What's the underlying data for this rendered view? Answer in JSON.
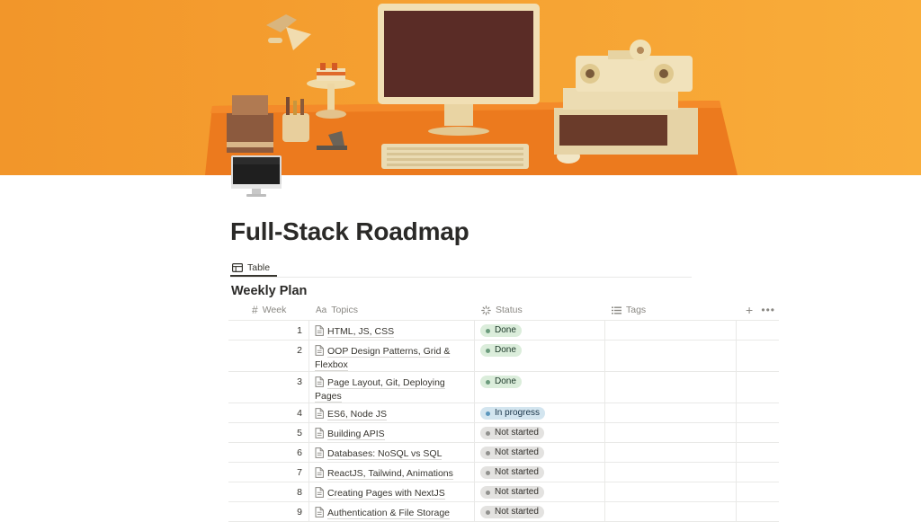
{
  "page": {
    "title": "Full-Stack Roadmap",
    "view_tab": "Table",
    "database_title": "Weekly Plan"
  },
  "columns": {
    "week": "Week",
    "topics": "Topics",
    "status": "Status",
    "tags": "Tags"
  },
  "icons": {
    "cover": "orange-desk-computer-illustration",
    "page_icon": "desktop-computer-icon",
    "view_tab": "table-icon",
    "week_col": "number-hash-icon",
    "topics_col": "text-aa-icon",
    "status_col": "status-loader-icon",
    "tags_col": "list-icon",
    "row_page": "document-icon",
    "add_column": "plus-icon",
    "more": "ellipsis-icon"
  },
  "status_styles": {
    "Done": {
      "bg": "#dbeddb",
      "dot": "#6c9b7d",
      "fg": "#1c3829"
    },
    "In progress": {
      "bg": "#d3e5ef",
      "dot": "#5b97bd",
      "fg": "#183347"
    },
    "Not started": {
      "bg": "#e3e2e0",
      "dot": "#91918e",
      "fg": "#32302c"
    }
  },
  "rows": [
    {
      "week": "1",
      "topic": "HTML, JS, CSS",
      "status": "Done"
    },
    {
      "week": "2",
      "topic": "OOP Design Patterns, Grid & Flexbox",
      "status": "Done"
    },
    {
      "week": "3",
      "topic": "Page Layout, Git, Deploying Pages",
      "status": "Done"
    },
    {
      "week": "4",
      "topic": "ES6, Node JS",
      "status": "In progress"
    },
    {
      "week": "5",
      "topic": "Building APIS",
      "status": "Not started"
    },
    {
      "week": "6",
      "topic": "Databases: NoSQL vs SQL",
      "status": "Not started"
    },
    {
      "week": "7",
      "topic": "ReactJS, Tailwind, Animations",
      "status": "Not started"
    },
    {
      "week": "8",
      "topic": "Creating Pages with NextJS",
      "status": "Not started"
    },
    {
      "week": "9",
      "topic": "Authentication & File Storage",
      "status": "Not started"
    }
  ]
}
